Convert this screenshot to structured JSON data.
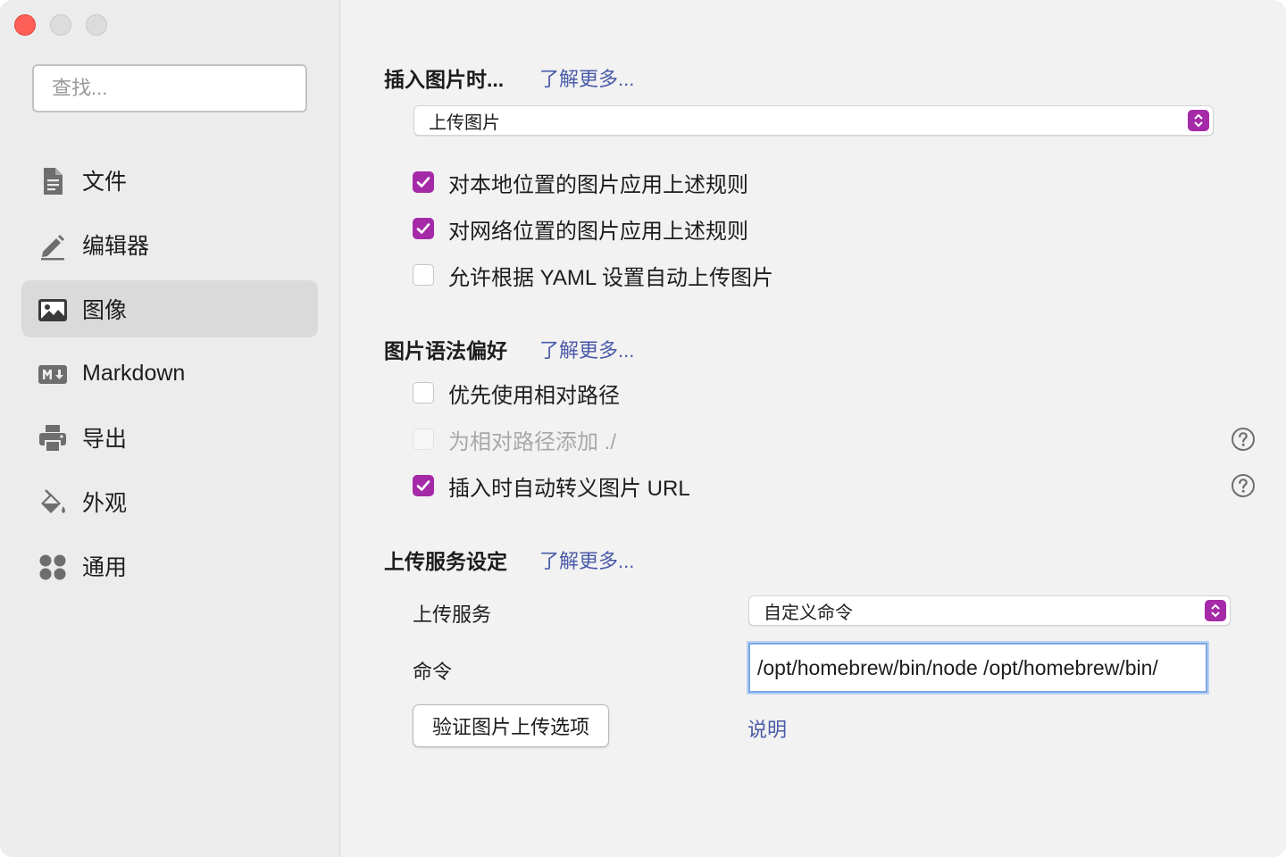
{
  "colors": {
    "accent": "#a52aa8",
    "link": "#4a5ba8",
    "close": "#fe5f57"
  },
  "sidebar": {
    "search_placeholder": "查找...",
    "items": [
      {
        "label": "文件",
        "icon": "document-icon",
        "active": false
      },
      {
        "label": "编辑器",
        "icon": "pencil-icon",
        "active": false
      },
      {
        "label": "图像",
        "icon": "image-icon",
        "active": true
      },
      {
        "label": "Markdown",
        "icon": "markdown-icon",
        "active": false
      },
      {
        "label": "导出",
        "icon": "printer-icon",
        "active": false
      },
      {
        "label": "外观",
        "icon": "paint-bucket-icon",
        "active": false
      },
      {
        "label": "通用",
        "icon": "grid-dots-icon",
        "active": false
      }
    ]
  },
  "insert": {
    "title": "插入图片时...",
    "learn_more": "了解更多...",
    "action_select": "上传图片",
    "options": [
      {
        "label": "对本地位置的图片应用上述规则",
        "checked": true
      },
      {
        "label": "对网络位置的图片应用上述规则",
        "checked": true
      },
      {
        "label": "允许根据 YAML 设置自动上传图片",
        "checked": false
      }
    ]
  },
  "syntax": {
    "title": "图片语法偏好",
    "learn_more": "了解更多...",
    "options": [
      {
        "label": "优先使用相对路径",
        "checked": false,
        "disabled": false
      },
      {
        "label": "为相对路径添加 ./",
        "checked": false,
        "disabled": true
      },
      {
        "label": "插入时自动转义图片 URL",
        "checked": true,
        "disabled": false
      }
    ]
  },
  "upload": {
    "title": "上传服务设定",
    "learn_more": "了解更多...",
    "service_label": "上传服务",
    "service_value": "自定义命令",
    "command_label": "命令",
    "command_value": "/opt/homebrew/bin/node /opt/homebrew/bin/",
    "verify_button": "验证图片上传选项",
    "explain_link": "说明"
  }
}
